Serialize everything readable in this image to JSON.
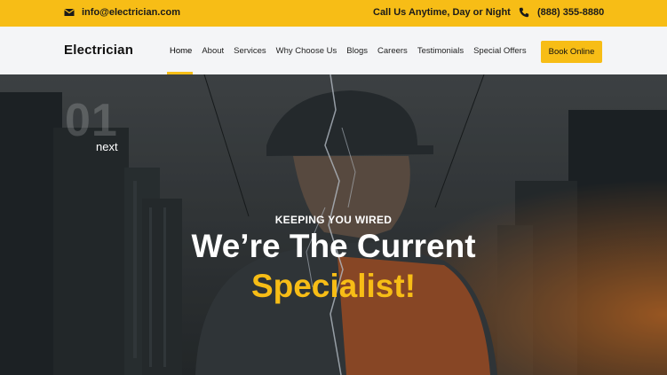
{
  "topbar": {
    "email": "info@electrician.com",
    "call_text": "Call Us Anytime, Day or Night",
    "phone": "(888) 355-8880",
    "email_icon": "envelope-icon",
    "phone_icon": "phone-icon"
  },
  "header": {
    "logo": "Electrician",
    "nav": [
      "Home",
      "About",
      "Services",
      "Why Choose Us",
      "Blogs",
      "Careers",
      "Testimonials",
      "Special Offers"
    ],
    "active_nav": "Home",
    "cta": "Book Online"
  },
  "hero": {
    "slide_number": "01",
    "next_label": "next",
    "eyebrow": "KEEPING YOU WIRED",
    "headline_line1": "We’re The Current",
    "headline_line2": "Specialist!"
  },
  "colors": {
    "accent": "#f7bd16",
    "header_bg": "#f4f5f7",
    "hero_text": "#ffffff"
  }
}
